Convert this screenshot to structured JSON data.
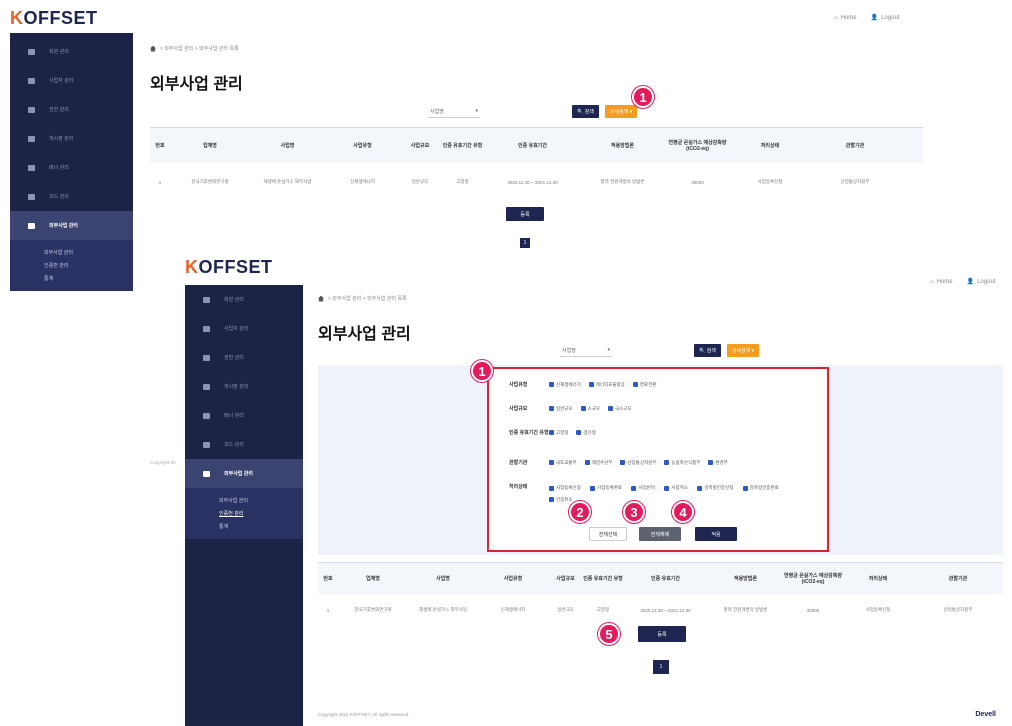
{
  "app": {
    "logo_prefix": "K",
    "logo_rest": "OFFSET",
    "home_label": "Home",
    "logout_label": "Logout"
  },
  "sidebar": {
    "items": [
      {
        "label": "회원 관리"
      },
      {
        "label": "사업자 관리"
      },
      {
        "label": "권한 관리"
      },
      {
        "label": "게시판 관리"
      },
      {
        "label": "배너 관리"
      },
      {
        "label": "코드 관리"
      },
      {
        "label": "외부사업 관리"
      }
    ],
    "sub_items": [
      {
        "label": "외부사업 관리"
      },
      {
        "label": "인증번 관리"
      },
      {
        "label": "통계"
      }
    ]
  },
  "page": {
    "breadcrumb": "> 외부사업 관리 > 외부사업 관리 목록",
    "title": "외부사업 관리",
    "search_select": "사업명",
    "search_button": "검색",
    "detail_button": "상세검색 ▾",
    "register_button": "등록",
    "page_number": "1",
    "copyright": "Copyright 2021 KOFFSET. All rights reserved.",
    "copyright_short": "Copyright 20",
    "developer": "Devell"
  },
  "table": {
    "headers": [
      "번호",
      "업체명",
      "사업명",
      "사업유형",
      "사업규모",
      "인증 유효기간 유형",
      "인증 유효기간",
      "적용방법론",
      "연평균 온실가스 예상감축량 (tCO2-eq)",
      "처리상태",
      "관할기관"
    ],
    "row": [
      "1",
      "한국기후변화연구원",
      "재생에 온실가스 외부사업",
      "신재생에너지",
      "일반규모",
      "고정형",
      "2020.12.30 ~ 2021.12.30",
      "풍력 전원개발의 방법론",
      "30000",
      "사업등록신청",
      "산업통상자원부"
    ]
  },
  "detail_search": {
    "rows": [
      {
        "label": "사업유형",
        "options": [
          "신재생에너지",
          "에너지효율향상",
          "연료전환"
        ]
      },
      {
        "label": "사업규모",
        "options": [
          "일반규모",
          "소규모",
          "극소규모"
        ]
      },
      {
        "label": "인증 유효기간 유형",
        "options": [
          "고정형",
          "갱신형"
        ]
      },
      {
        "label": "관할기관",
        "options": [
          "국토교통부",
          "해양수산부",
          "산업통상자원부",
          "농림축산식품부",
          "환경부"
        ]
      },
      {
        "label": "처리상태",
        "options": [
          "사업등록신청",
          "사업등록완료",
          "사업반려",
          "사업취소",
          "감축량인증신청",
          "감축량인증완료",
          "인증취소"
        ]
      }
    ],
    "select_all": "전체선택",
    "deselect_all": "전체해제",
    "apply": "적용"
  },
  "badges": [
    "1",
    "1",
    "2",
    "3",
    "4",
    "5"
  ],
  "colors": {
    "navy": "#1d2550",
    "accent": "#f39c1e",
    "badge": "#e31b5c",
    "highlight": "#d9232d"
  }
}
